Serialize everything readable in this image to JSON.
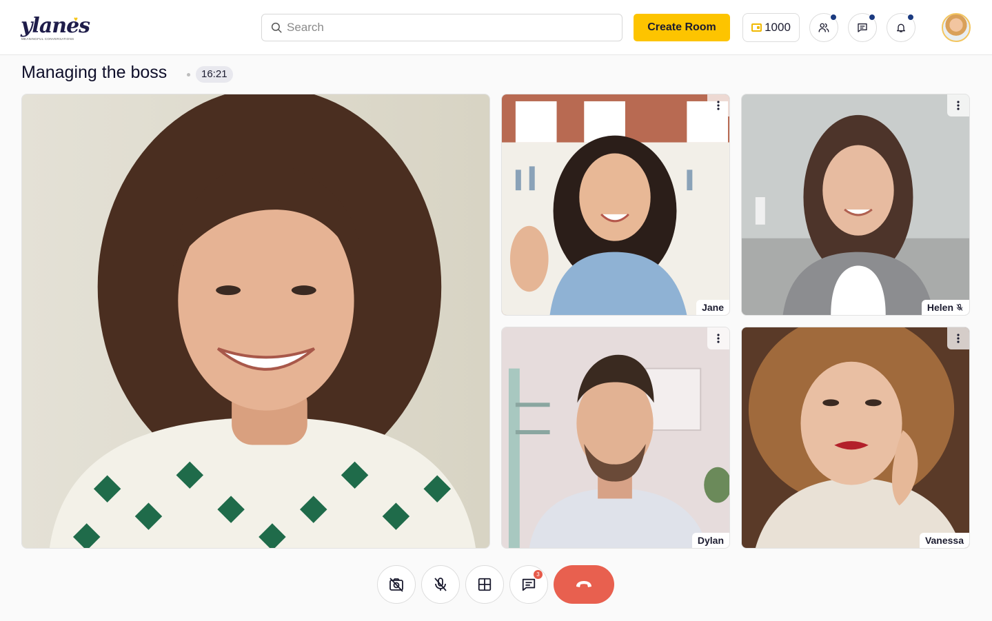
{
  "header": {
    "logo_text": "ylanes",
    "logo_tagline": "MEANINGFUL CONVERSATIONS",
    "search_placeholder": "Search",
    "create_room_label": "Create Room",
    "coins": "1000",
    "icons": [
      "people-icon",
      "chat-icon",
      "bell-icon"
    ]
  },
  "room": {
    "title": "Managing the boss",
    "timer": "16:21"
  },
  "participants": [
    {
      "name": "Jane",
      "muted": false
    },
    {
      "name": "Helen",
      "muted": true
    },
    {
      "name": "Dylan",
      "muted": false
    },
    {
      "name": "Vanessa",
      "muted": false
    }
  ],
  "controls": {
    "chat_badge": "3",
    "icons": [
      "camera-off-icon",
      "mic-off-icon",
      "grid-layout-icon",
      "chat-icon",
      "hangup-icon"
    ]
  },
  "colors": {
    "accent": "#fdc400",
    "hangup": "#e8604f",
    "notification_dot": "#1b3a80",
    "text": "#1b1b2f"
  }
}
